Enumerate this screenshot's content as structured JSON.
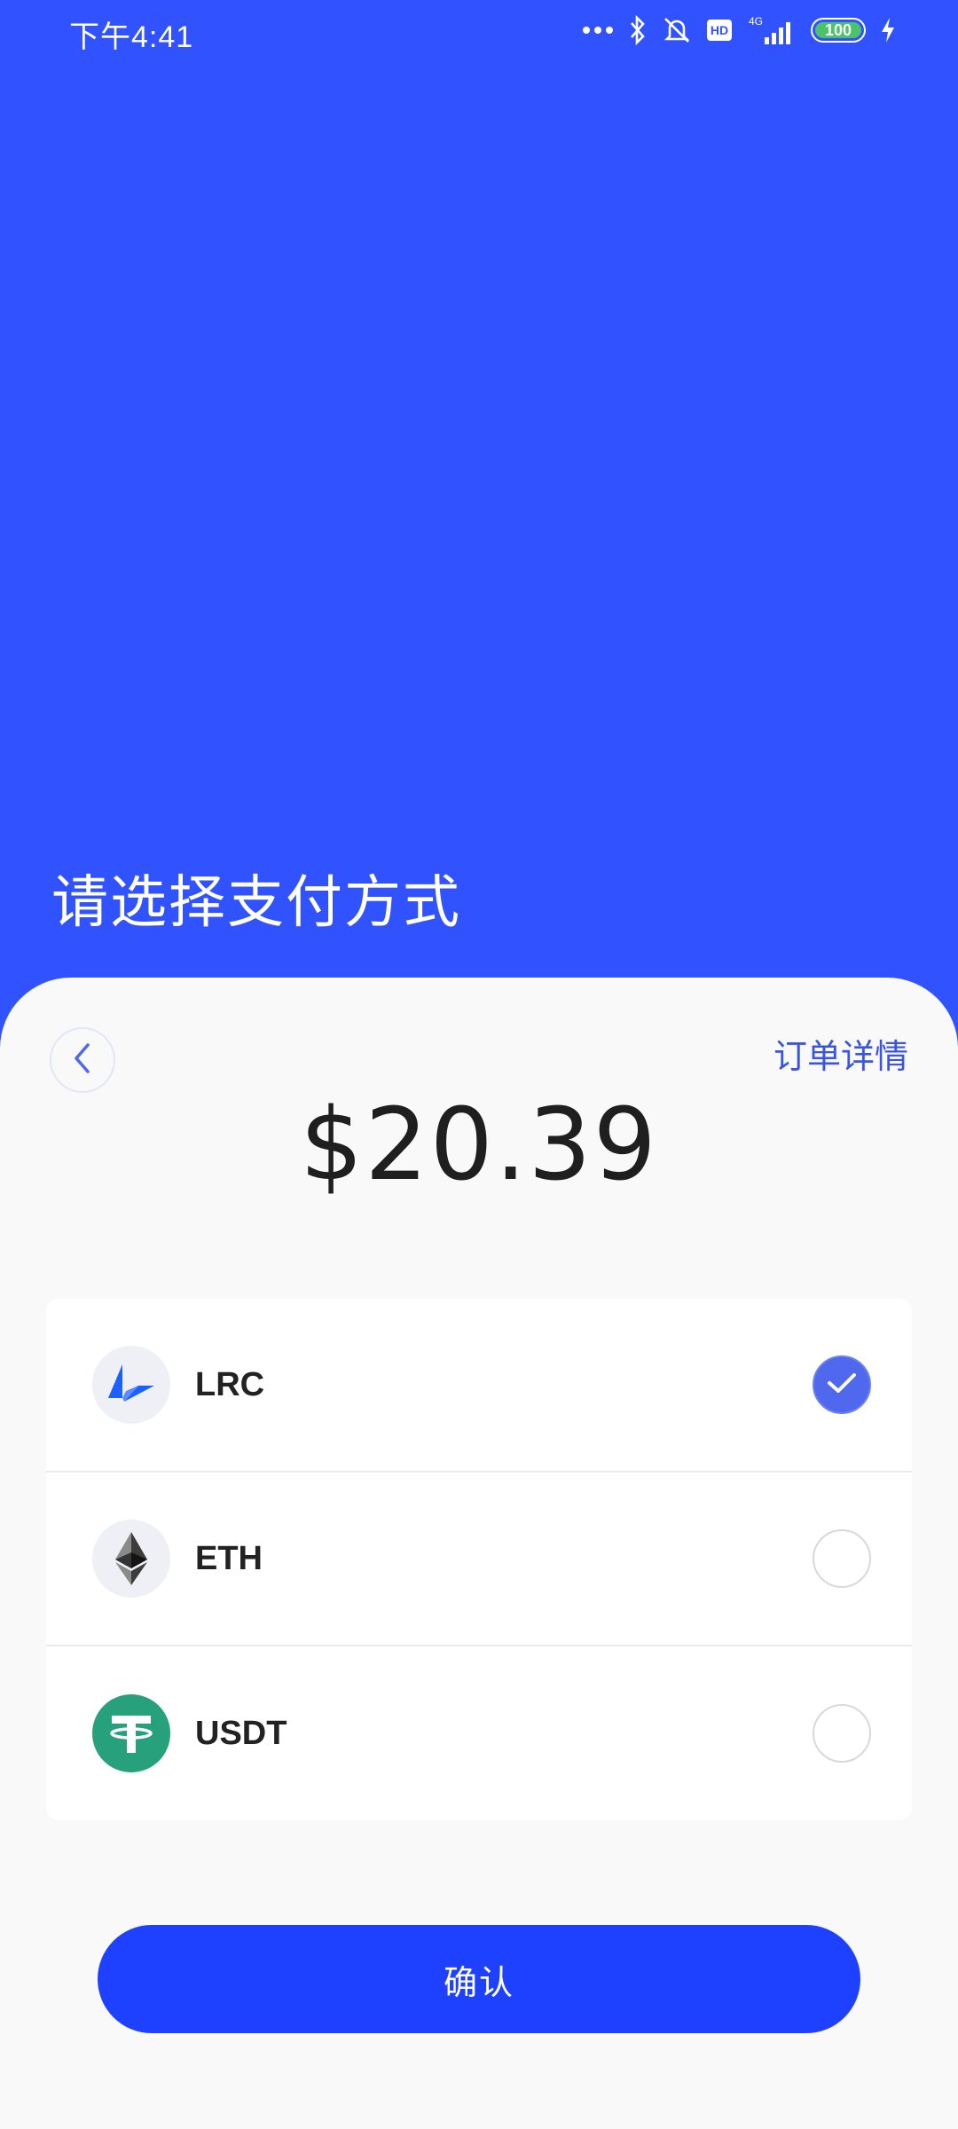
{
  "status_bar": {
    "time": "下午4:41",
    "network": "4G",
    "hd_badge": "HD",
    "battery": "100"
  },
  "header": {
    "title": "请选择支付方式"
  },
  "sheet": {
    "order_details_link": "订单详情",
    "amount": "$20.39"
  },
  "payment_methods": [
    {
      "label": "LRC",
      "icon": "lrc-coin-icon",
      "selected": true
    },
    {
      "label": "ETH",
      "icon": "eth-coin-icon",
      "selected": false
    },
    {
      "label": "USDT",
      "icon": "usdt-coin-icon",
      "selected": false
    }
  ],
  "confirm_button": {
    "label": "确认"
  },
  "colors": {
    "primary_blue": "#3053FF",
    "button_blue": "#1E41FF",
    "accent": "#4F68EE",
    "usdt_green": "#26A17B"
  }
}
